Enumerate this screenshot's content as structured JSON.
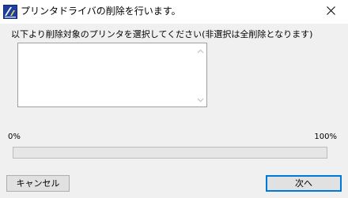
{
  "window": {
    "title": "プリンタドライバの削除を行います。",
    "app_icon": "printer-driver-app-icon",
    "close_icon": "close-icon"
  },
  "instruction": "以下より削除対象のプリンタを選択してください(非選択は全削除となります)",
  "printer_list": {
    "items": [],
    "scroll_up_icon": "chevron-up-icon",
    "scroll_down_icon": "chevron-down-icon"
  },
  "progress": {
    "min_label": "0%",
    "max_label": "100%",
    "value": 0
  },
  "buttons": {
    "cancel": "キャンセル",
    "next": "次へ"
  },
  "colors": {
    "dialog_bg": "#f0f0f0",
    "title_bg": "#ffffff",
    "default_button_border": "#0078d7"
  }
}
